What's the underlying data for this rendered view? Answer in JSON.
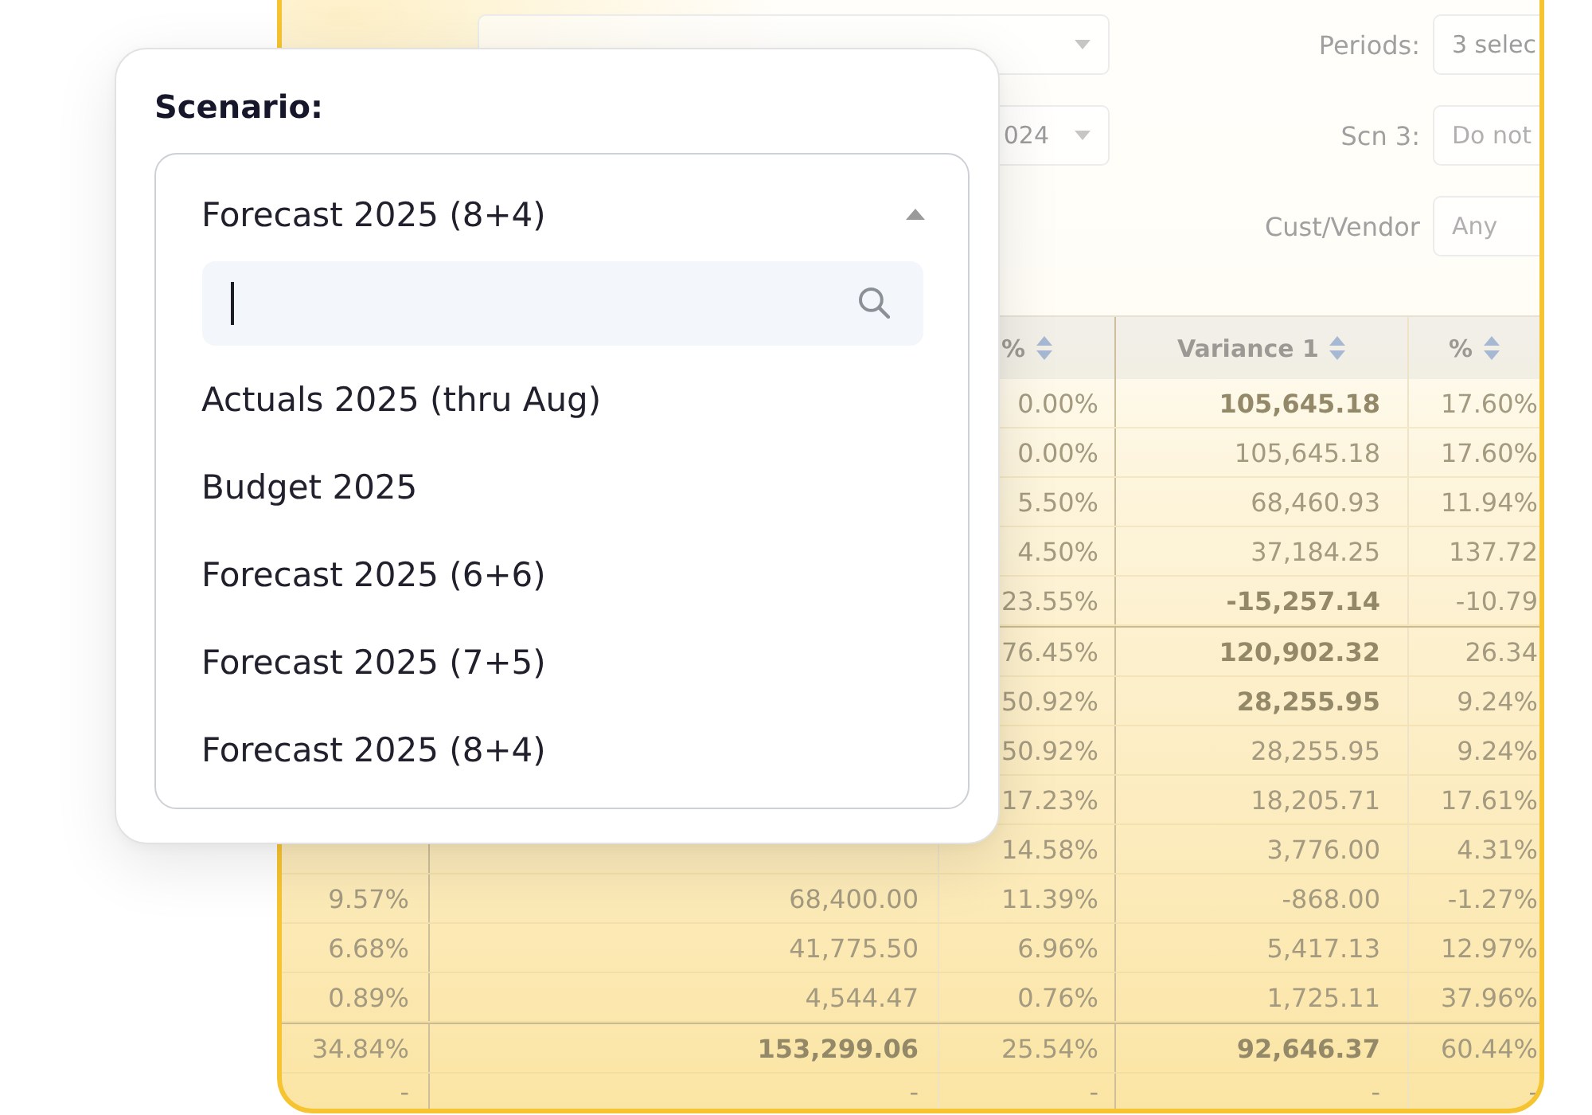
{
  "filters": [
    {
      "left": {
        "dropdown": true
      },
      "right": {
        "label": "Periods:",
        "value": "3 selec",
        "dropdown": false
      }
    },
    {
      "left": {
        "value": "024",
        "dropdown": true
      },
      "right": {
        "label": "Scn 3:",
        "placeholder": "Do not",
        "dropdown": false
      }
    },
    {
      "right": {
        "label": "Cust/Vendor",
        "placeholder": "Any",
        "dropdown": false
      }
    }
  ],
  "table": {
    "headers": {
      "percent_1": "%",
      "variance_1": "Variance 1",
      "percent_2": "%"
    },
    "sections": [
      {
        "rows": [
          {
            "bold": true,
            "cells": {
              "percent_1": "0.00%",
              "variance_1": "105,645.18",
              "percent_2": "17.60%"
            }
          },
          {
            "bold": false,
            "cells": {
              "percent_1": "0.00%",
              "variance_1": "105,645.18",
              "percent_2": "17.60%"
            }
          },
          {
            "bold": false,
            "cells": {
              "percent_1": "5.50%",
              "variance_1": "68,460.93",
              "percent_2": "11.94%"
            }
          },
          {
            "bold": false,
            "cells": {
              "percent_1": "4.50%",
              "variance_1": "37,184.25",
              "percent_2": "137.72"
            }
          },
          {
            "bold": true,
            "cells": {
              "percent_1": "23.55%",
              "variance_1": "-15,257.14",
              "percent_2": "-10.79"
            }
          }
        ]
      },
      {
        "rows": [
          {
            "bold": true,
            "cells": {
              "percent_1": "76.45%",
              "variance_1": "120,902.32",
              "percent_2": "26.34"
            }
          },
          {
            "bold": true,
            "cells": {
              "percent_1": "50.92%",
              "variance_1": "28,255.95",
              "percent_2": "9.24%"
            }
          },
          {
            "bold": false,
            "cells": {
              "percent_1": "50.92%",
              "variance_1": "28,255.95",
              "percent_2": "9.24%"
            }
          },
          {
            "bold": false,
            "cells": {
              "percent_1": "17.23%",
              "variance_1": "18,205.71",
              "percent_2": "17.61%"
            }
          },
          {
            "bold": false,
            "cells": {
              "percent_1": "14.58%",
              "variance_1": "3,776.00",
              "percent_2": "4.31%"
            }
          },
          {
            "bold": false,
            "cells": {
              "column_1": "9.57%",
              "column_2": "68,400.00",
              "percent_1": "11.39%",
              "variance_1": "-868.00",
              "percent_2": "-1.27%"
            }
          },
          {
            "bold": false,
            "cells": {
              "column_1": "6.68%",
              "column_2": "41,775.50",
              "percent_1": "6.96%",
              "variance_1": "5,417.13",
              "percent_2": "12.97%"
            }
          },
          {
            "bold": false,
            "cells": {
              "column_1": "0.89%",
              "column_2": "4,544.47",
              "percent_1": "0.76%",
              "variance_1": "1,725.11",
              "percent_2": "37.96%"
            }
          }
        ]
      },
      {
        "rows": [
          {
            "bold": true,
            "cells": {
              "column_1": "34.84%",
              "column_2": "153,299.06",
              "percent_1": "25.54%",
              "variance_1": "92,646.37",
              "percent_2": "60.44%"
            }
          },
          {
            "bold": false,
            "cells": {
              "column_1": "-",
              "column_2": "-",
              "percent_1": "-",
              "variance_1": "-",
              "percent_2": "-"
            }
          }
        ]
      }
    ]
  },
  "scenario_popup": {
    "title": "Scenario:",
    "select": {
      "value": "Forecast 2025 (8+4)",
      "expanded": true,
      "search": {
        "focused": true
      },
      "options": [
        "Actuals 2025 (thru Aug)",
        "Budget 2025",
        "Forecast 2025 (6+6)",
        "Forecast 2025 (7+5)",
        "Forecast 2025 (8+4)"
      ]
    }
  }
}
